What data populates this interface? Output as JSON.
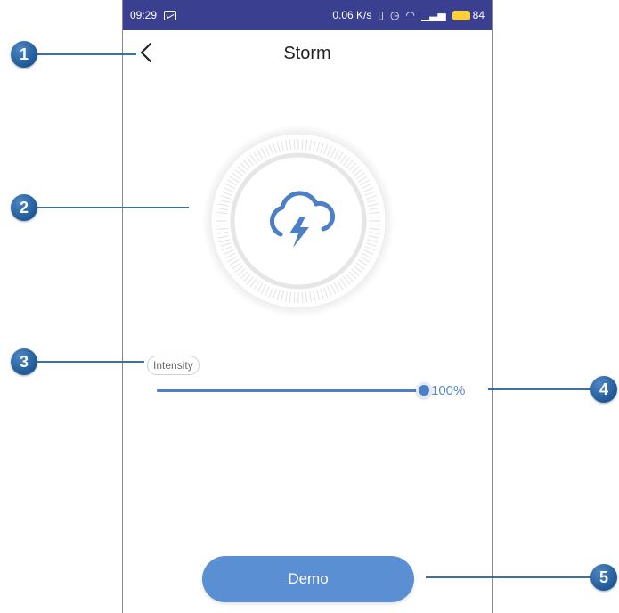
{
  "status_bar": {
    "time": "09:29",
    "speed": "0.06 K/s",
    "battery_level": "84",
    "bg_color": "#3a3f8f"
  },
  "header": {
    "title": "Storm",
    "back_icon": "chevron-left-icon"
  },
  "main": {
    "weather_icon": "cloud-lightning-icon",
    "intensity_label": "Intensity",
    "slider": {
      "value_fraction": 1.0,
      "value_text": "100%"
    },
    "demo_label": "Demo",
    "accent_color": "#4d7fc6"
  },
  "callouts": [
    "1",
    "2",
    "3",
    "4",
    "5"
  ]
}
